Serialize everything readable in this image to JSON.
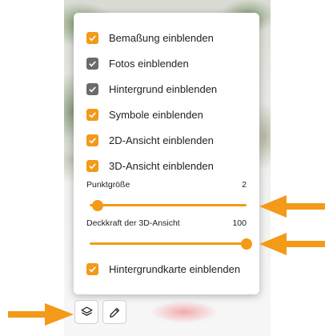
{
  "colors": {
    "accent": "#f39a18",
    "unchecked_dark": "#6b6b6b",
    "annotation_arrow": "#f39a18"
  },
  "options": [
    {
      "label": "Bemaßung einblenden",
      "checked": true,
      "style": "orange"
    },
    {
      "label": "Fotos einblenden",
      "checked": true,
      "style": "gray"
    },
    {
      "label": "Hintergrund einblenden",
      "checked": true,
      "style": "gray"
    },
    {
      "label": "Symbole einblenden",
      "checked": true,
      "style": "orange"
    },
    {
      "label": "2D-Ansicht einblenden",
      "checked": true,
      "style": "orange"
    },
    {
      "label": "3D-Ansicht einblenden",
      "checked": true,
      "style": "orange"
    }
  ],
  "point_size": {
    "label": "Punktgröße",
    "value": "2",
    "level": 0.05
  },
  "opacity_3d": {
    "label": "Deckkraft der 3D-Ansicht",
    "value": "100",
    "level": 1.0
  },
  "background_map": {
    "label": "Hintergrundkarte einblenden",
    "checked": true
  },
  "toolbar": {
    "layers_icon": "layers-icon",
    "edit_icon": "pencil-icon"
  }
}
